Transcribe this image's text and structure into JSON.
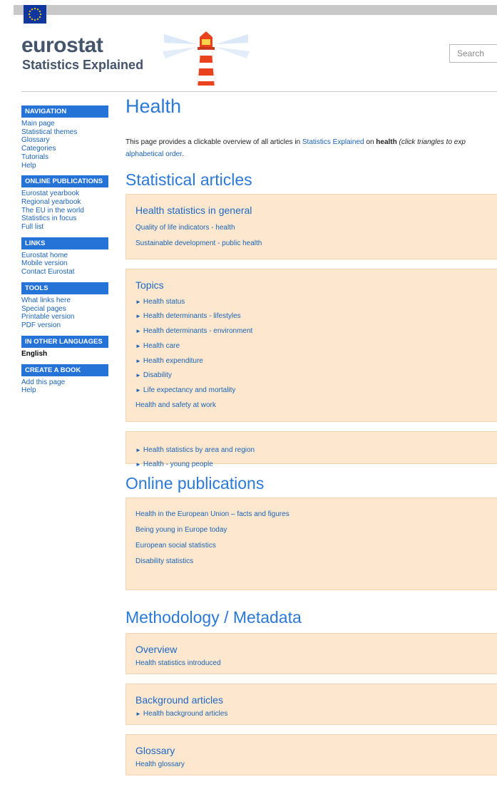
{
  "header": {
    "logo_word": "eurostat",
    "logo_sub": "Statistics Explained",
    "search_placeholder": "Search"
  },
  "sidebar": {
    "sections": [
      {
        "heading": "NAVIGATION",
        "items": [
          "Main page",
          "Statistical themes",
          "Glossary",
          "Categories",
          "Tutorials",
          "Help"
        ]
      },
      {
        "heading": "ONLINE PUBLICATIONS",
        "items": [
          "Eurostat yearbook",
          "Regional yearbook",
          "The EU in the world",
          "Statistics in focus",
          "Full list"
        ]
      },
      {
        "heading": "LINKS",
        "items": [
          "Eurostat home",
          "Mobile version",
          "Contact Eurostat"
        ]
      },
      {
        "heading": "TOOLS",
        "items": [
          "What links here",
          "Special pages",
          "Printable version",
          "PDF version"
        ]
      },
      {
        "heading": "IN OTHER LANGUAGES",
        "items": [
          "English"
        ]
      },
      {
        "heading": "CREATE A BOOK",
        "items": [
          "Add this page",
          "Help"
        ]
      }
    ]
  },
  "main": {
    "title": "Health",
    "intro": {
      "part1": "This page provides a clickable overview of all articles in ",
      "link": "Statistics Explained",
      "part2": " on ",
      "bold": "health",
      "italic": "(click triangles to exp",
      "line2_link": "alphabetical order",
      "line2_end": "."
    },
    "sections": {
      "statistical_articles": "Statistical articles",
      "online_publications": "Online publications",
      "methodology": "Methodology / Metadata"
    },
    "boxes": {
      "general": {
        "title": "Health statistics in general",
        "links": [
          "Quality of life indicators - health",
          "Sustainable development - public health"
        ]
      },
      "topics": {
        "title": "Topics",
        "links": [
          "Health status",
          "Health determinants - lifestyles",
          "Health determinants - environment",
          "Health care",
          "Health expenditure",
          "Disability",
          "Life expectancy and mortality"
        ],
        "extra": "Health and safety at work"
      },
      "regional": {
        "links": [
          "Health statistics by area and region",
          "Health - young people"
        ]
      },
      "publications": {
        "links": [
          "Health in the European Union – facts and figures",
          "Being young in Europe today",
          "European social statistics",
          "Disability statistics"
        ]
      },
      "overview": {
        "title": "Overview",
        "link": "Health statistics introduced"
      },
      "background": {
        "title": "Background articles",
        "link": "Health background articles"
      },
      "glossary": {
        "title": "Glossary",
        "link": "Health glossary"
      }
    }
  },
  "icons": {
    "triangle": "►",
    "eu_flag": "eu-flag-icon",
    "lighthouse": "lighthouse-logo-icon"
  },
  "colors": {
    "accent": "#2b79d6",
    "sidebar_head": "#2673d8",
    "box_bg": "#fde8cf",
    "link": "#1b63b5"
  }
}
